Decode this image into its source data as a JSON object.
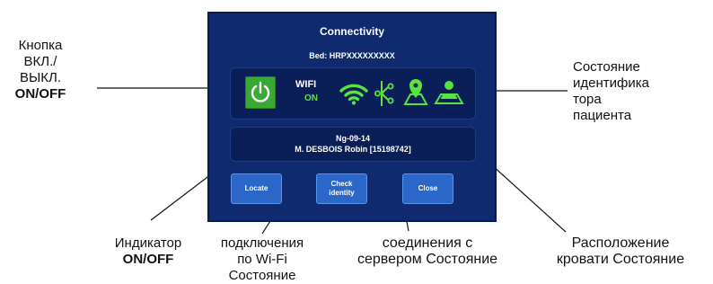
{
  "device": {
    "title": "Connectivity",
    "bed": "Bed: HRPXXXXXXXXX",
    "wifi_label": "WIFI",
    "wifi_state": "ON",
    "patient_line1": "Ng-09-14",
    "patient_line2": "M. DESBOIS Robin [15198742]",
    "buttons": {
      "locate": "Locate",
      "check_line1": "Check",
      "check_line2": "identity",
      "close": "Close"
    }
  },
  "callouts": {
    "power_button": {
      "line1": "Кнопка",
      "line2": "ВКЛ./",
      "line3": "ВЫКЛ.",
      "line4": "ON/OFF"
    },
    "patient_id_status": {
      "line1": "Состояние",
      "line2": "идентифика",
      "line3": "тора",
      "line4": "пациента"
    },
    "indicator": {
      "line1": "Индикатор",
      "line2": "ON/OFF"
    },
    "wifi_status": {
      "line1": "подключения",
      "line2": "по Wi-Fi",
      "line3": "Состояние"
    },
    "server_status": {
      "line1": "соединения с",
      "line2": "сервером Состояние"
    },
    "bed_location": {
      "line1": "Расположение",
      "line2": "кровати Состояние"
    }
  },
  "colors": {
    "panel": "#0f2a6e",
    "status_green": "#58e33f",
    "power_green": "#39a935",
    "button_blue": "#2b67c8"
  },
  "icons": [
    "power-icon",
    "wifi-icon",
    "server-connection-icon",
    "bed-location-icon",
    "patient-identity-icon"
  ]
}
